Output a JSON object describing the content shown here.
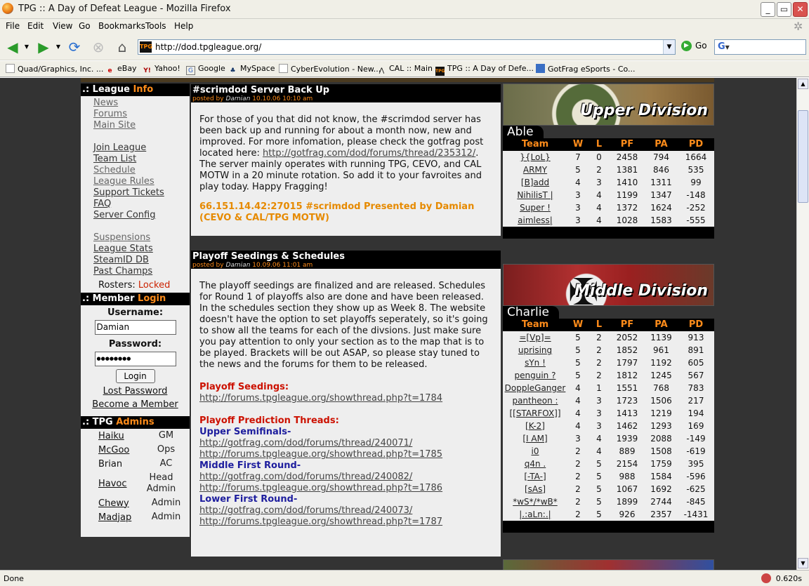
{
  "window": {
    "title": "TPG :: A Day of Defeat League - Mozilla Firefox"
  },
  "menu": [
    "File",
    "Edit",
    "View",
    "Go",
    "Bookmarks",
    "Tools",
    "Help"
  ],
  "address": {
    "url": "http://dod.tpgleague.org/",
    "go": "Go",
    "search_glyph": "G"
  },
  "bookmarks": [
    "Quad/Graphics, Inc. ...",
    "eBay",
    "Yahoo!",
    "Google",
    "MySpace",
    "CyberEvolution - New...",
    "CAL :: Main",
    "TPG :: A Day of Defe...",
    "GotFrag eSports - Co..."
  ],
  "status": {
    "text": "Done",
    "time": "0.620s"
  },
  "left": {
    "info_head": [
      ".: League ",
      "Info"
    ],
    "nav": [
      "News",
      "Forums",
      "Main Site",
      "Join League",
      "Team List",
      "Schedule",
      "League Rules",
      "Support Tickets",
      "FAQ",
      "Server Config",
      "Suspensions",
      "League Stats",
      "SteamID DB",
      "Past Champs"
    ],
    "rosters_label": "Rosters:",
    "rosters_value": "Locked",
    "login_head": [
      ".: Member ",
      "Login"
    ],
    "username_label": "Username:",
    "username_value": "Damian",
    "password_label": "Password:",
    "password_value": "●●●●●●●●",
    "login_button": "Login",
    "lost_password": "Lost Password",
    "become_member": "Become a Member",
    "admins_head": [
      ".: TPG ",
      "Admins"
    ],
    "admins": [
      {
        "name": "Haiku",
        "role": "GM"
      },
      {
        "name": "McGoo",
        "role": "Ops"
      },
      {
        "name": "Brian",
        "role": "AC"
      },
      {
        "name": "Havoc",
        "role": "Head Admin"
      },
      {
        "name": "Chewy",
        "role": "Admin"
      },
      {
        "name": "Madjap",
        "role": "Admin"
      }
    ]
  },
  "posts": [
    {
      "title": "#scrimdod Server Back Up",
      "posted_by": "posted by",
      "author": "Damian",
      "date": "10.10.06 10:10 am",
      "body_pre": "For those of you that did not know, the #scrimdod server has been back up and running for about a month now, new and improved. For more infomation, please check the gotfrag post located here: ",
      "link": "http://gotfrag.com/dod/forums/thread/235312/",
      "body_post": ". The server mainly operates with running TPG, CEVO, and CAL MOTW in a 20 minute rotation. So add it to your favroites and play today. Happy Fragging!",
      "highlight": "66.151.14.42:27015 #scrimdod Presented by Damian (CEVO & CAL/TPG MOTW)"
    },
    {
      "title": "Playoff Seedings & Schedules",
      "posted_by": "posted by",
      "author": "Damian",
      "date": "10.09.06 11:01 am",
      "body": "The playoff seedings are finalized and are released. Schedules for Round 1 of playoffs also are done and have been released. In the schedules section they show up as Week 8. The website doesn't have the option to set playoffs seperately, so it's going to show all the teams for each of the divsions. Just make sure you pay attention to only your section as to the map that is to be played. Brackets will be out ASAP, so please stay tuned to the news and the forums for them to be released.",
      "seedings_label": "Playoff Seedings:",
      "seedings_link": "http://forums.tpgleague.org/showthread.php?t=1784",
      "prediction_label": "Playoff Prediction Threads:",
      "groups": [
        {
          "label": "Upper Semifinals-",
          "links": [
            "http://gotfrag.com/dod/forums/thread/240071/",
            "http://forums.tpgleague.org/showthread.php?t=1785"
          ]
        },
        {
          "label": "Middle First Round-",
          "links": [
            "http://gotfrag.com/dod/forums/thread/240082/",
            "http://forums.tpgleague.org/showthread.php?t=1786"
          ]
        },
        {
          "label": "Lower First Round-",
          "links": [
            "http://gotfrag.com/dod/forums/thread/240073/",
            "http://forums.tpgleague.org/showthread.php?t=1787"
          ]
        }
      ]
    }
  ],
  "divisions": [
    {
      "banner": "Upper Division",
      "group": "Able",
      "headers": [
        "Team",
        "W",
        "L",
        "PF",
        "PA",
        "PD"
      ],
      "rows": [
        [
          "}{LoL}",
          "7",
          "0",
          "2458",
          "794",
          "1664"
        ],
        [
          "ARMY",
          "5",
          "2",
          "1381",
          "846",
          "535"
        ],
        [
          "[B]add",
          "4",
          "3",
          "1410",
          "1311",
          "99"
        ],
        [
          "NihilisT |",
          "3",
          "4",
          "1199",
          "1347",
          "-148"
        ],
        [
          "Super !",
          "3",
          "4",
          "1372",
          "1624",
          "-252"
        ],
        [
          "aimless|",
          "3",
          "4",
          "1028",
          "1583",
          "-555"
        ]
      ]
    },
    {
      "banner": "Middle Division",
      "group": "Charlie",
      "headers": [
        "Team",
        "W",
        "L",
        "PF",
        "PA",
        "PD"
      ],
      "rows": [
        [
          "=[Vp]=",
          "5",
          "2",
          "2052",
          "1139",
          "913"
        ],
        [
          "uprising",
          "5",
          "2",
          "1852",
          "961",
          "891"
        ],
        [
          "sYn !",
          "5",
          "2",
          "1797",
          "1192",
          "605"
        ],
        [
          "penguin ?",
          "5",
          "2",
          "1812",
          "1245",
          "567"
        ],
        [
          "DoppleGanger",
          "4",
          "1",
          "1551",
          "768",
          "783"
        ],
        [
          "pantheon :",
          "4",
          "3",
          "1723",
          "1506",
          "217"
        ],
        [
          "[[STARFOX]]",
          "4",
          "3",
          "1413",
          "1219",
          "194"
        ],
        [
          "[K-2]",
          "4",
          "3",
          "1462",
          "1293",
          "169"
        ],
        [
          "[I AM]",
          "3",
          "4",
          "1939",
          "2088",
          "-149"
        ],
        [
          "i0",
          "2",
          "4",
          "889",
          "1508",
          "-619"
        ],
        [
          "q4n .",
          "2",
          "5",
          "2154",
          "1759",
          "395"
        ],
        [
          "[-TA-]",
          "2",
          "5",
          "988",
          "1584",
          "-596"
        ],
        [
          "[sAs]",
          "2",
          "5",
          "1067",
          "1692",
          "-625"
        ],
        [
          "*wS*/*wB*",
          "2",
          "5",
          "1899",
          "2744",
          "-845"
        ],
        [
          "|.:aLn:.|",
          "2",
          "5",
          "926",
          "2357",
          "-1431"
        ]
      ]
    }
  ],
  "colors": {
    "accent": "#ff8c1a",
    "panel": "#eeeeee",
    "page_bg": "#333333",
    "header_bg": "#000000"
  }
}
